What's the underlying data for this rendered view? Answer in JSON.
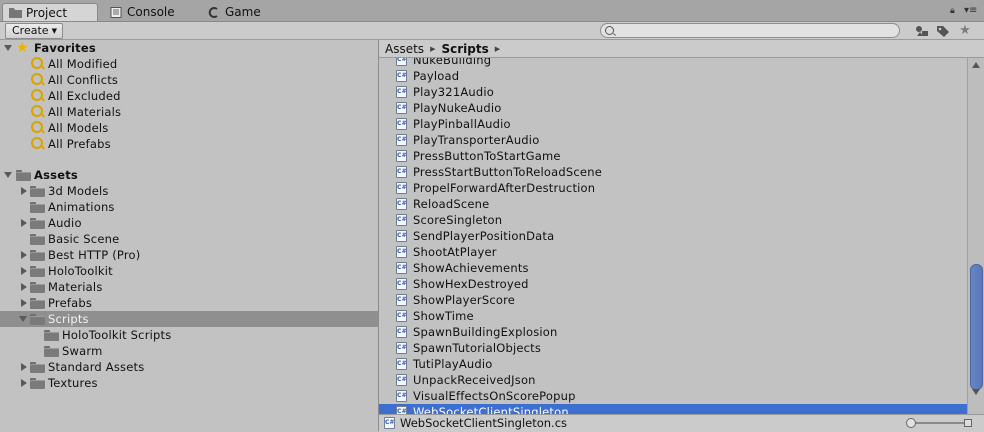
{
  "tabs": [
    {
      "label": "Project",
      "icon": "folder-icon",
      "active": true
    },
    {
      "label": "Console",
      "icon": "console-icon",
      "active": false
    },
    {
      "label": "Game",
      "icon": "game-icon",
      "active": false
    }
  ],
  "toolbar": {
    "create_label": "Create",
    "search_value": "",
    "icons": [
      "filter-by-type-icon",
      "filter-by-label-icon",
      "favorite-star-icon"
    ]
  },
  "favorites": {
    "title": "Favorites",
    "items": [
      "All Modified",
      "All Conflicts",
      "All Excluded",
      "All Materials",
      "All Models",
      "All Prefabs"
    ]
  },
  "assets": {
    "title": "Assets",
    "folders": [
      {
        "label": "3d Models",
        "has_children": true
      },
      {
        "label": "Animations",
        "has_children": false
      },
      {
        "label": "Audio",
        "has_children": true
      },
      {
        "label": "Basic Scene",
        "has_children": false
      },
      {
        "label": "Best HTTP (Pro)",
        "has_children": true
      },
      {
        "label": "HoloToolkit",
        "has_children": true
      },
      {
        "label": "Materials",
        "has_children": true
      },
      {
        "label": "Prefabs",
        "has_children": true
      },
      {
        "label": "Scripts",
        "has_children": true,
        "expanded": true,
        "selected": true,
        "children": [
          "HoloToolkit Scripts",
          "Swarm"
        ]
      },
      {
        "label": "Standard Assets",
        "has_children": true
      },
      {
        "label": "Textures",
        "has_children": true
      }
    ]
  },
  "breadcrumb": [
    "Assets",
    "Scripts"
  ],
  "files": [
    "NukeBuilding",
    "Payload",
    "Play321Audio",
    "PlayNukeAudio",
    "PlayPinballAudio",
    "PlayTransporterAudio",
    "PressButtonToStartGame",
    "PressStartButtonToReloadScene",
    "PropelForwardAfterDestruction",
    "ReloadScene",
    "ScoreSingleton",
    "SendPlayerPositionData",
    "ShootAtPlayer",
    "ShowAchievements",
    "ShowHexDestroyed",
    "ShowPlayerScore",
    "ShowTime",
    "SpawnBuildingExplosion",
    "SpawnTutorialObjects",
    "TutiPlayAudio",
    "UnpackReceivedJson",
    "VisualEffectsOnScorePopup",
    "WebSocketClientSingleton"
  ],
  "selected_file": "WebSocketClientSingleton",
  "status": {
    "selected_path": "WebSocketClientSingleton.cs"
  },
  "colors": {
    "selection": "#3d6fd1",
    "tree_selection": "#8f8f8f",
    "background": "#c2c2c2"
  }
}
